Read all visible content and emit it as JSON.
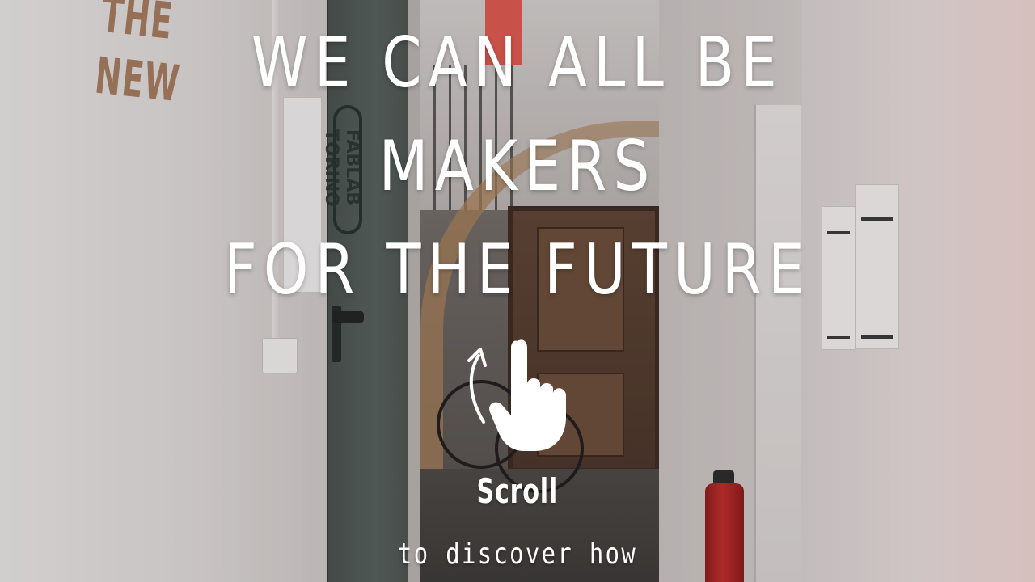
{
  "hero": {
    "headline_lines": [
      "WE CAN ALL BE",
      "MAKERS",
      "FOR THE FUTURE"
    ]
  },
  "scroll_hint": {
    "icon": "hand-swipe-up-icon",
    "label": "Scroll",
    "sublabel": "to discover how"
  },
  "background": {
    "wall_text": "THE NEW",
    "logo_text": "FABLAB TORINO",
    "accent_color": "#ffffff"
  }
}
